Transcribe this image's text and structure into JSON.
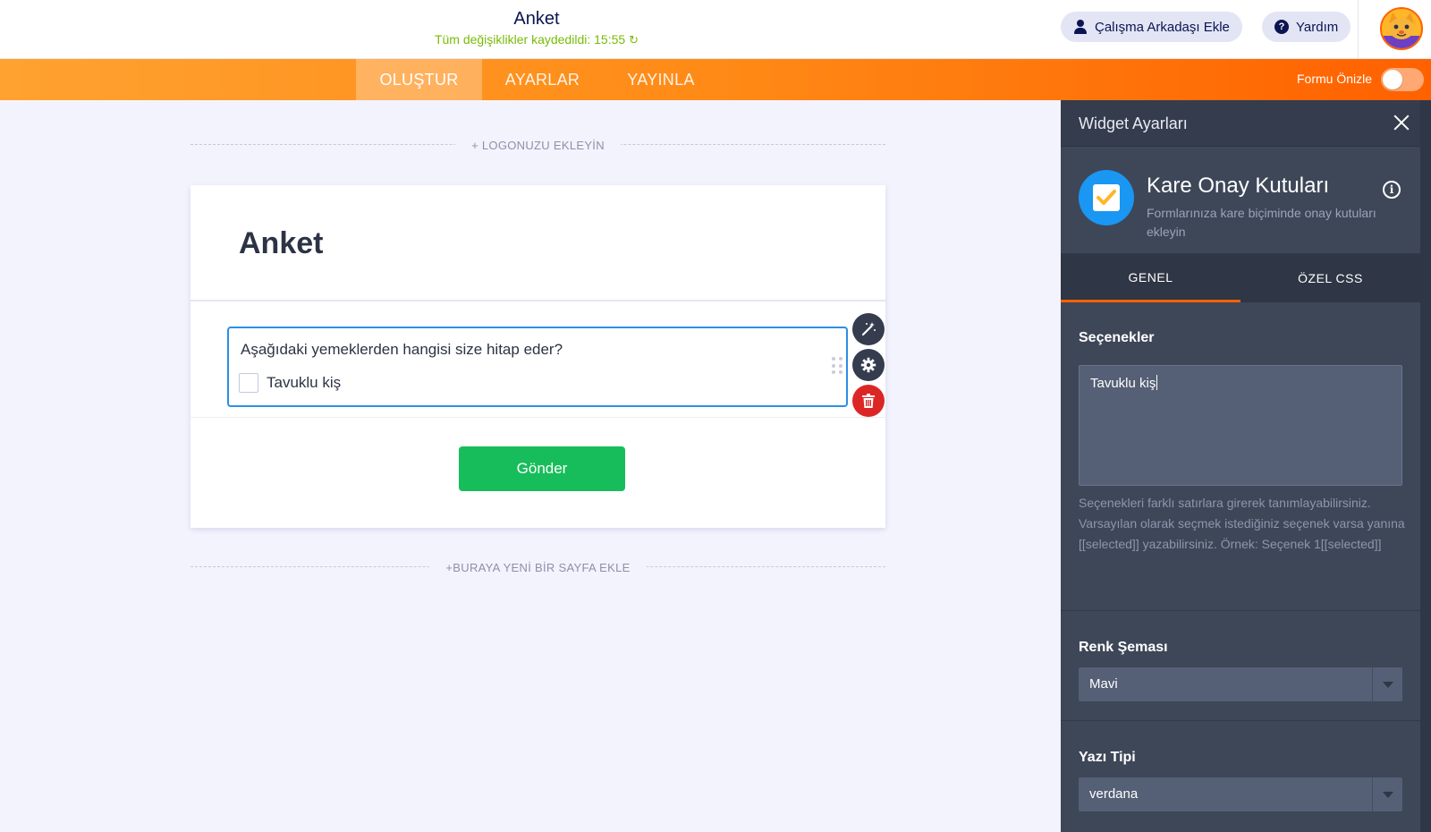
{
  "header": {
    "title": "Anket",
    "save_status": "Tüm değişiklikler kaydedildi: 15:55",
    "collab_label": "Çalışma Arkadaşı Ekle",
    "help_label": "Yardım"
  },
  "nav": {
    "tabs": [
      "OLUŞTUR",
      "AYARLAR",
      "YAYINLA"
    ],
    "active_tab": "OLUŞTUR",
    "preview_label": "Formu Önizle",
    "preview_on": false
  },
  "canvas": {
    "add_logo": "+ LOGONUZU EKLEYİN",
    "add_page": "+BURAYA YENİ BİR SAYFA EKLE",
    "form_title": "Anket",
    "question": "Aşağıdaki yemeklerden hangisi size hitap eder?",
    "option_1": "Tavuklu kiş",
    "submit_label": "Gönder"
  },
  "panel": {
    "title": "Widget Ayarları",
    "widget_name": "Kare Onay Kutuları",
    "widget_desc": "Formlarınıza kare biçiminde onay kutuları ekleyin",
    "tab_general": "GENEL",
    "tab_css": "ÖZEL CSS",
    "options_label": "Seçenekler",
    "options_value": "Tavuklu kiş",
    "options_help": "Seçenekleri farklı satırlara girerek tanımlayabilirsiniz. Varsayılan olarak seçmek istediğiniz seçenek varsa yanına [[selected]] yazabilirsiniz. Örnek: Seçenek 1[[selected]]",
    "color_label": "Renk Şeması",
    "color_value": "Mavi",
    "font_label": "Yazı Tipi",
    "font_value": "verdana"
  },
  "colors": {
    "accent_orange": "#ff6100",
    "submit_green": "#18bd5b",
    "focus_blue": "#2a8fe6",
    "delete_red": "#dc2626",
    "save_green": "#78bb07"
  }
}
